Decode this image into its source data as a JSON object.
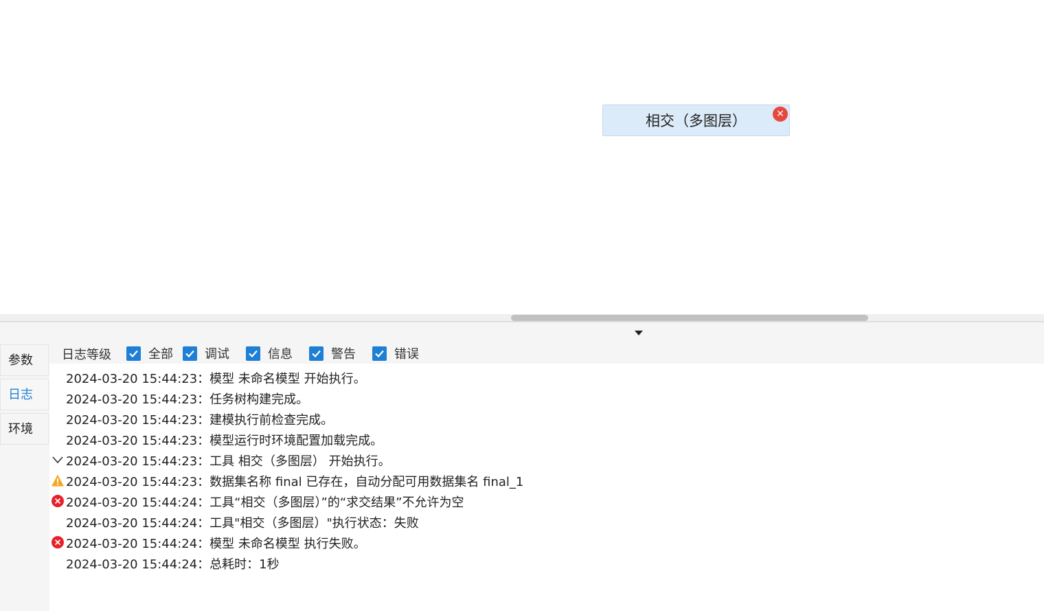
{
  "canvas": {
    "node_label": "相交（多图层）",
    "node_status_icon": "error-x-icon"
  },
  "side_tabs": [
    {
      "label": "参数",
      "active": false
    },
    {
      "label": "日志",
      "active": true
    },
    {
      "label": "环境",
      "active": false
    }
  ],
  "filter": {
    "label": "日志等级",
    "options": [
      {
        "label": "全部",
        "checked": true
      },
      {
        "label": "调试",
        "checked": true
      },
      {
        "label": "信息",
        "checked": true
      },
      {
        "label": "警告",
        "checked": true
      },
      {
        "label": "错误",
        "checked": true
      }
    ]
  },
  "log": [
    {
      "icon": "none",
      "text": "2024-03-20 15:44:23：模型 未命名模型 开始执行。"
    },
    {
      "icon": "none",
      "text": "2024-03-20 15:44:23：任务树构建完成。"
    },
    {
      "icon": "none",
      "text": "2024-03-20 15:44:23：建模执行前检查完成。"
    },
    {
      "icon": "none",
      "text": "2024-03-20 15:44:23：模型运行时环境配置加载完成。"
    },
    {
      "icon": "chevron-down-icon",
      "text": "2024-03-20 15:44:23：工具 相交（多图层） 开始执行。"
    },
    {
      "icon": "warning-icon",
      "text": "2024-03-20 15:44:23：数据集名称 final 已存在，自动分配可用数据集名 final_1"
    },
    {
      "icon": "error-icon",
      "text": "2024-03-20 15:44:24：工具“相交（多图层）”的“求交结果”不允许为空"
    },
    {
      "icon": "none",
      "text": "2024-03-20 15:44:24：工具\"相交（多图层）\"执行状态：失败"
    },
    {
      "icon": "error-icon",
      "text": "2024-03-20 15:44:24：模型 未命名模型 执行失败。"
    },
    {
      "icon": "none",
      "text": "2024-03-20 15:44:24：总耗时：1秒"
    }
  ],
  "colors": {
    "accent": "#1e7fd4",
    "node_bg": "#dcebf9",
    "error": "#e8202a",
    "warning": "#f5a623"
  }
}
